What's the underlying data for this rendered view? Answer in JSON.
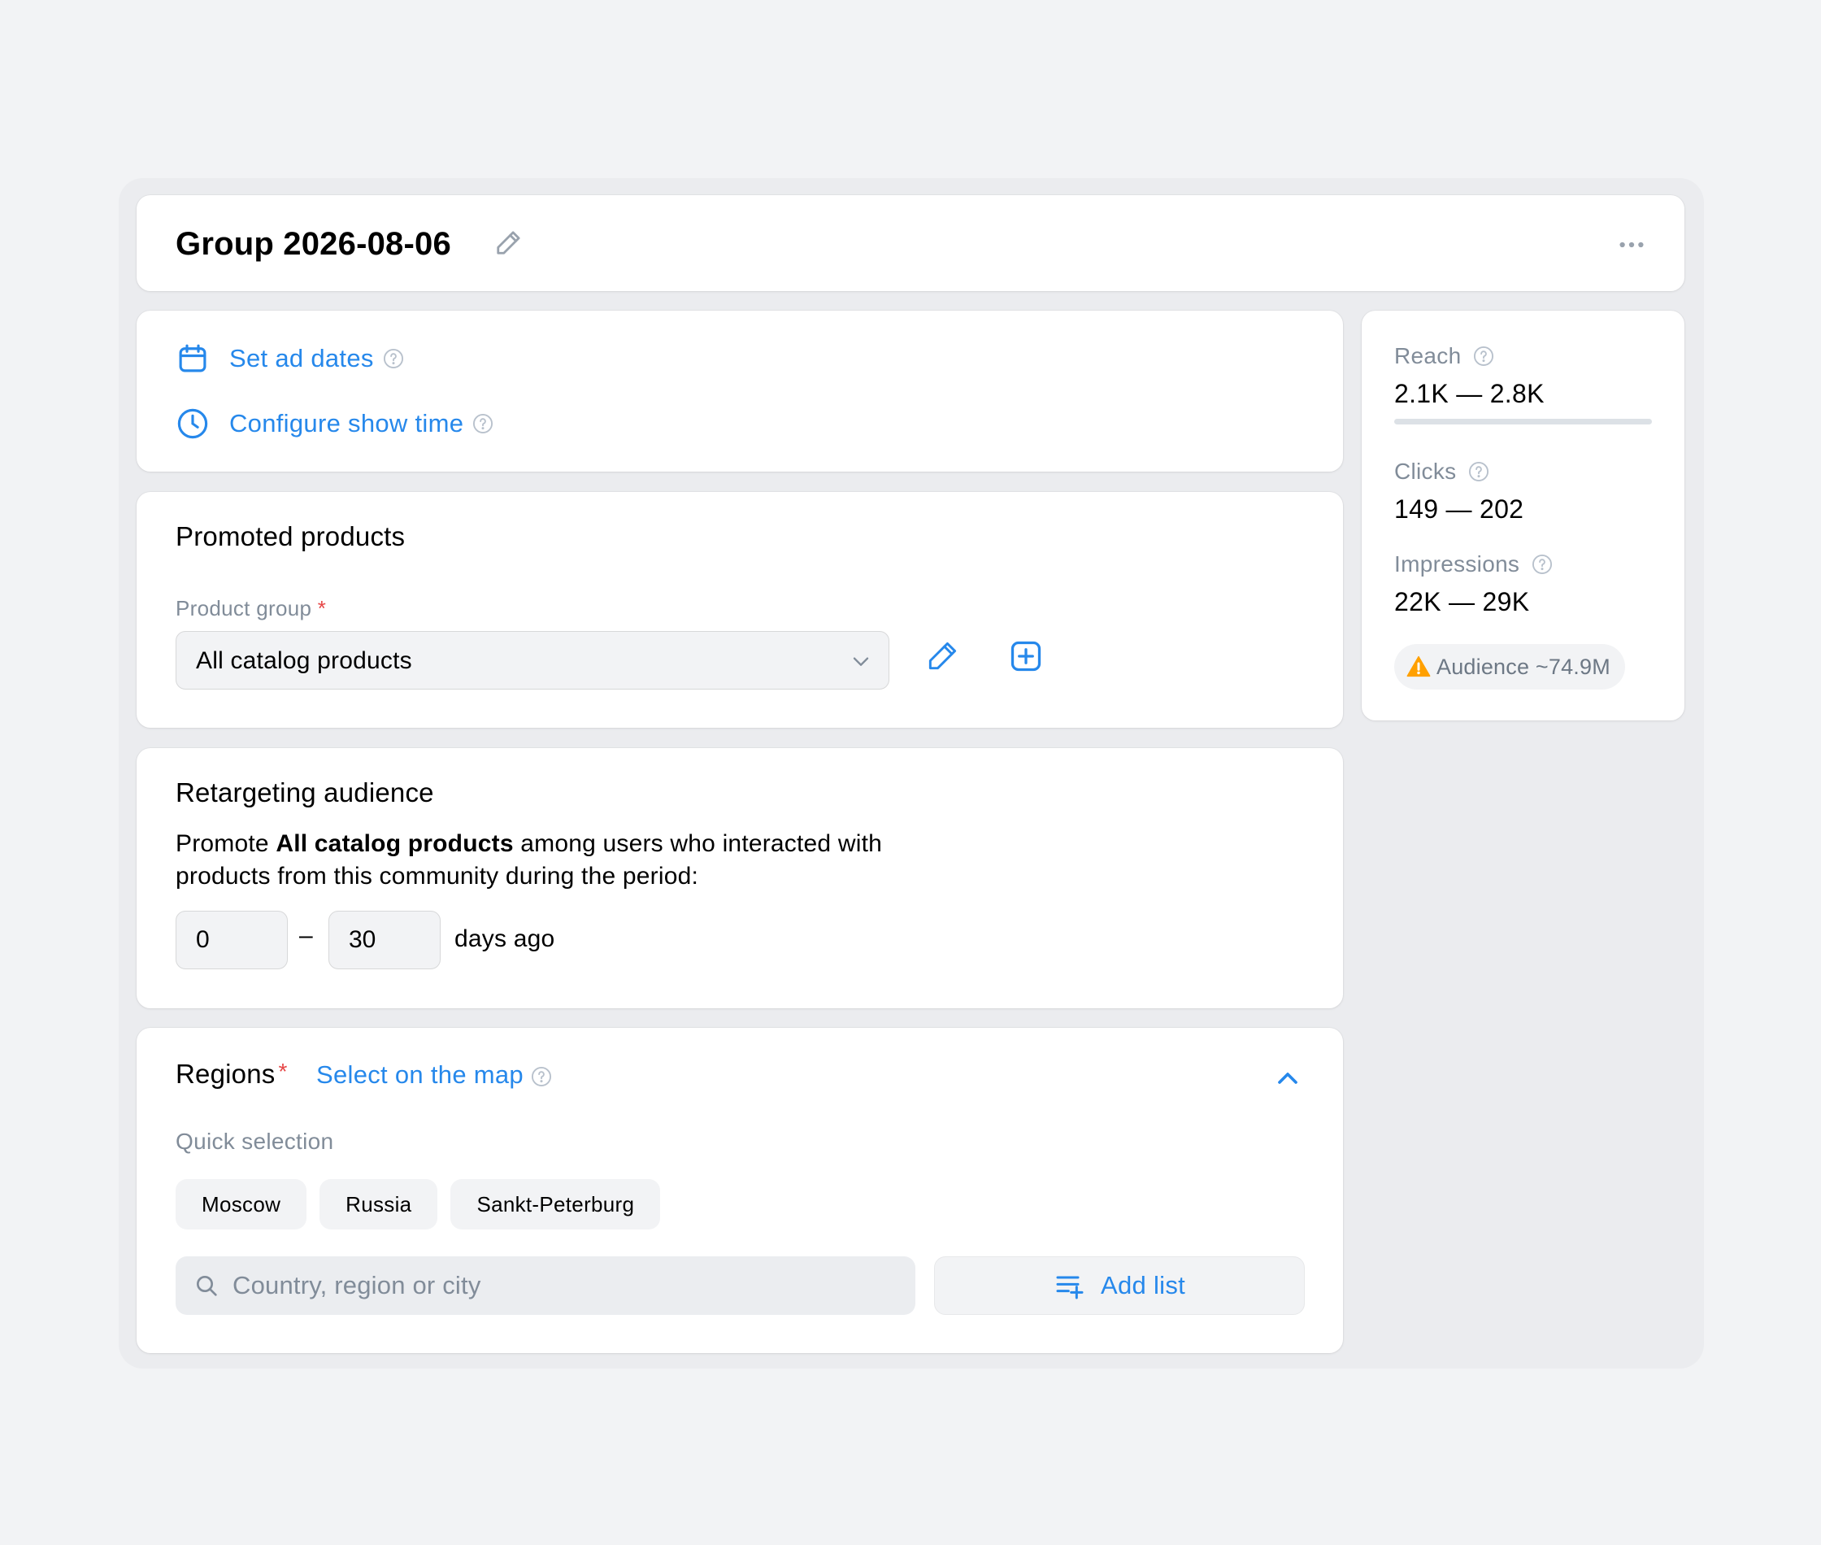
{
  "header": {
    "title": "Group 2026-08-06"
  },
  "dates": {
    "set_dates": "Set ad dates",
    "show_time": "Configure show time"
  },
  "promoted": {
    "title": "Promoted products",
    "field_label": "Product group",
    "required_mark": "*",
    "selected": "All catalog products"
  },
  "retargeting": {
    "title": "Retargeting audience",
    "desc_prefix": "Promote ",
    "desc_bold": "All catalog products",
    "desc_suffix": " among users who interacted with products from this community during the period:",
    "from_value": "0",
    "to_value": "30",
    "dash": "–",
    "days_label": "days ago"
  },
  "regions": {
    "title": "Regions",
    "required_mark": "*",
    "map_link": "Select on the map",
    "quick_label": "Quick selection",
    "chips": [
      "Moscow",
      "Russia",
      "Sankt-Peterburg"
    ],
    "search_placeholder": "Country, region or city",
    "add_list": "Add list"
  },
  "stats": {
    "reach_label": "Reach",
    "reach_value": "2.1K — 2.8K",
    "reach_progress": 0.0,
    "clicks_label": "Clicks",
    "clicks_value": "149 — 202",
    "impressions_label": "Impressions",
    "impressions_value": "22K — 29K",
    "audience": "Audience ~74.9M"
  },
  "colors": {
    "accent": "#2688eb",
    "required": "#e64646",
    "warning": "#ffa000",
    "secondary_text": "#818c99"
  }
}
